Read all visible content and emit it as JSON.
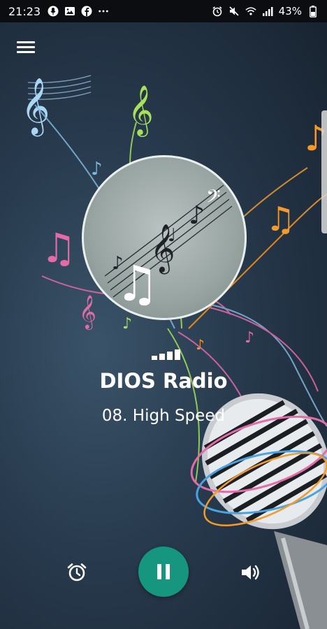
{
  "status_bar": {
    "time": "21:23",
    "battery": "43%",
    "left_icons": [
      "mic-icon",
      "image-icon",
      "facebook-icon",
      "more-icon"
    ],
    "right_icons": [
      "alarm-icon",
      "mute-icon",
      "wifi-icon",
      "signal-icon",
      "battery-icon"
    ]
  },
  "player": {
    "station_name": "DIOS Radio",
    "track_title": "08. High Speed",
    "state": "playing",
    "accent_color": "#17967f"
  },
  "controls": {
    "left": "alarm-clock-icon",
    "center": "pause-icon",
    "right": "volume-icon"
  }
}
